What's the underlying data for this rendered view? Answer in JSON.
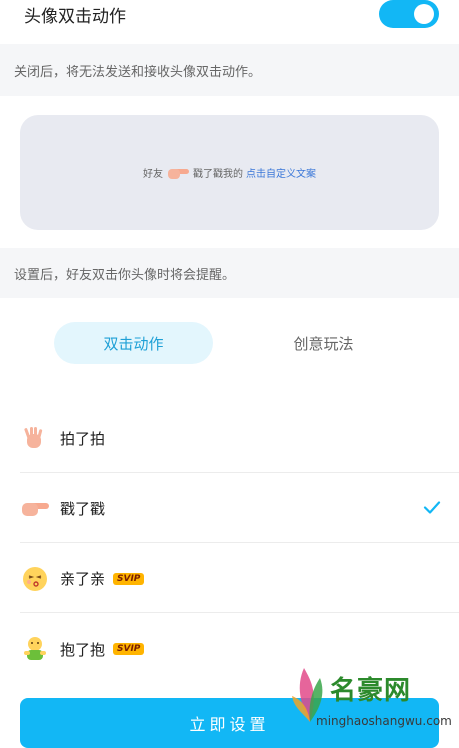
{
  "header": {
    "toggle_label": "头像双击动作",
    "toggle_on": true,
    "toggle_color": "#12b7f5"
  },
  "notes": {
    "off_note": "关闭后，将无法发送和接收头像双击动作。",
    "set_note": "设置后，好友双击你头像时将会提醒。"
  },
  "preview": {
    "friend": "好友",
    "action": "戳了戳我的",
    "link": "点击自定义文案"
  },
  "tabs": [
    {
      "label": "双击动作",
      "active": true
    },
    {
      "label": "创意玩法",
      "active": false
    }
  ],
  "actions": [
    {
      "label": "拍了拍",
      "icon": "clap-hand-icon",
      "svip": false,
      "selected": false
    },
    {
      "label": "戳了戳",
      "icon": "pointing-finger-icon",
      "svip": false,
      "selected": true
    },
    {
      "label": "亲了亲",
      "icon": "kiss-face-icon",
      "svip": true,
      "selected": false
    },
    {
      "label": "抱了抱",
      "icon": "hug-figure-icon",
      "svip": true,
      "selected": false
    }
  ],
  "svip_badge": "SVIP",
  "cta": {
    "label": "立即设置"
  },
  "watermark": {
    "title": "名豪网",
    "url": "minghaoshangwu.com"
  }
}
